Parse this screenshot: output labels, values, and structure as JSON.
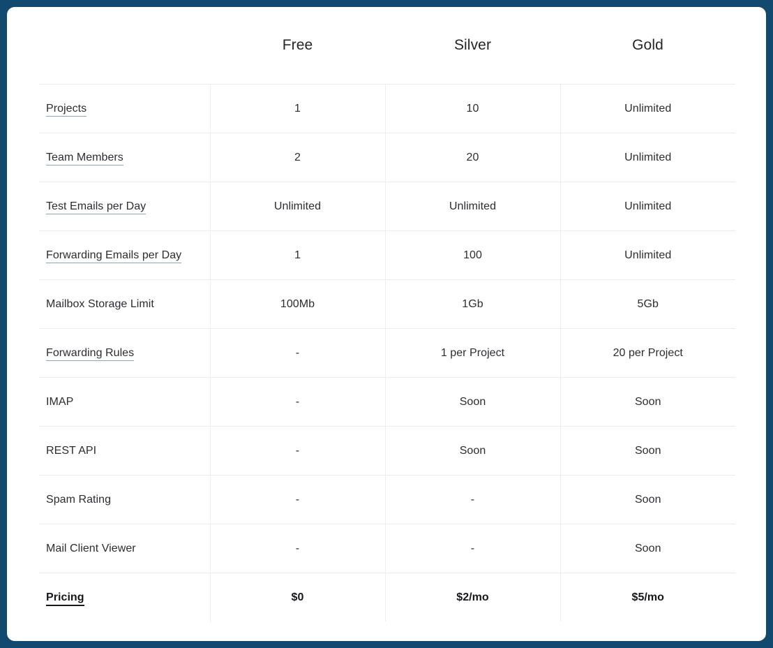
{
  "theme": {
    "page_background": "#12496e",
    "card_background": "#ffffff",
    "text_color": "#2c2c33",
    "rule_color": "#ececee",
    "link_underline_color": "#8fa6b6"
  },
  "table": {
    "feature_column_header": "",
    "plans": [
      "Free",
      "Silver",
      "Gold"
    ],
    "rows": [
      {
        "feature": "Projects",
        "is_link": true,
        "values": [
          "1",
          "10",
          "Unlimited"
        ]
      },
      {
        "feature": "Team Members",
        "is_link": true,
        "values": [
          "2",
          "20",
          "Unlimited"
        ]
      },
      {
        "feature": "Test Emails per Day",
        "is_link": true,
        "values": [
          "Unlimited",
          "Unlimited",
          "Unlimited"
        ]
      },
      {
        "feature": "Forwarding Emails per Day",
        "is_link": true,
        "values": [
          "1",
          "100",
          "Unlimited"
        ]
      },
      {
        "feature": "Mailbox Storage Limit",
        "is_link": false,
        "values": [
          "100Mb",
          "1Gb",
          "5Gb"
        ]
      },
      {
        "feature": "Forwarding Rules",
        "is_link": true,
        "values": [
          "-",
          "1 per Project",
          "20 per Project"
        ]
      },
      {
        "feature": "IMAP",
        "is_link": false,
        "values": [
          "-",
          "Soon",
          "Soon"
        ]
      },
      {
        "feature": "REST API",
        "is_link": false,
        "values": [
          "-",
          "Soon",
          "Soon"
        ]
      },
      {
        "feature": "Spam Rating",
        "is_link": false,
        "values": [
          "-",
          "-",
          "Soon"
        ]
      },
      {
        "feature": "Mail Client Viewer",
        "is_link": false,
        "values": [
          "-",
          "-",
          "Soon"
        ]
      },
      {
        "feature": "Pricing",
        "is_link": true,
        "emphasis": true,
        "values": [
          "$0",
          "$2/mo",
          "$5/mo"
        ]
      }
    ]
  }
}
